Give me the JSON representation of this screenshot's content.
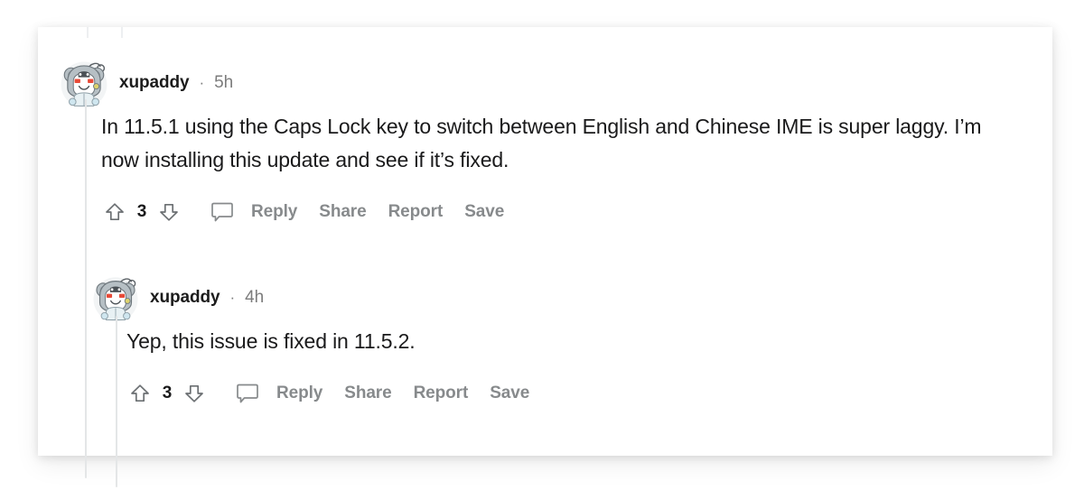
{
  "page": {
    "background_color": "#ffffff",
    "card_background": "#ffffff",
    "thread_line_color": "#e4e6e7",
    "text_color": "#1a1a1b",
    "muted_color": "#878a8c"
  },
  "comments": [
    {
      "author": "xupaddy",
      "separator": "·",
      "timestamp": "5h",
      "body": "In 11.5.1 using the Caps Lock key to switch between English and Chinese IME is super laggy. I’m now installing this update and see if it’s fixed.",
      "score": "3",
      "actions": {
        "upvote_icon": "upvote-arrow-icon",
        "downvote_icon": "downvote-arrow-icon",
        "comment_icon": "comment-bubble-icon",
        "reply_label": "Reply",
        "share_label": "Share",
        "report_label": "Report",
        "save_label": "Save"
      }
    },
    {
      "author": "xupaddy",
      "separator": "·",
      "timestamp": "4h",
      "body": "Yep, this issue is fixed in 11.5.2.",
      "score": "3",
      "actions": {
        "upvote_icon": "upvote-arrow-icon",
        "downvote_icon": "downvote-arrow-icon",
        "comment_icon": "comment-bubble-icon",
        "reply_label": "Reply",
        "share_label": "Share",
        "report_label": "Report",
        "save_label": "Save"
      }
    }
  ],
  "avatar": {
    "alt": "koala-hoodie-snoo-avatar",
    "body_color": "#e8f1f4",
    "hood_color": "#b6bfc4",
    "face_color": "#ffffff",
    "blush_color": "#e84b38",
    "outline_color": "#4a5055"
  }
}
